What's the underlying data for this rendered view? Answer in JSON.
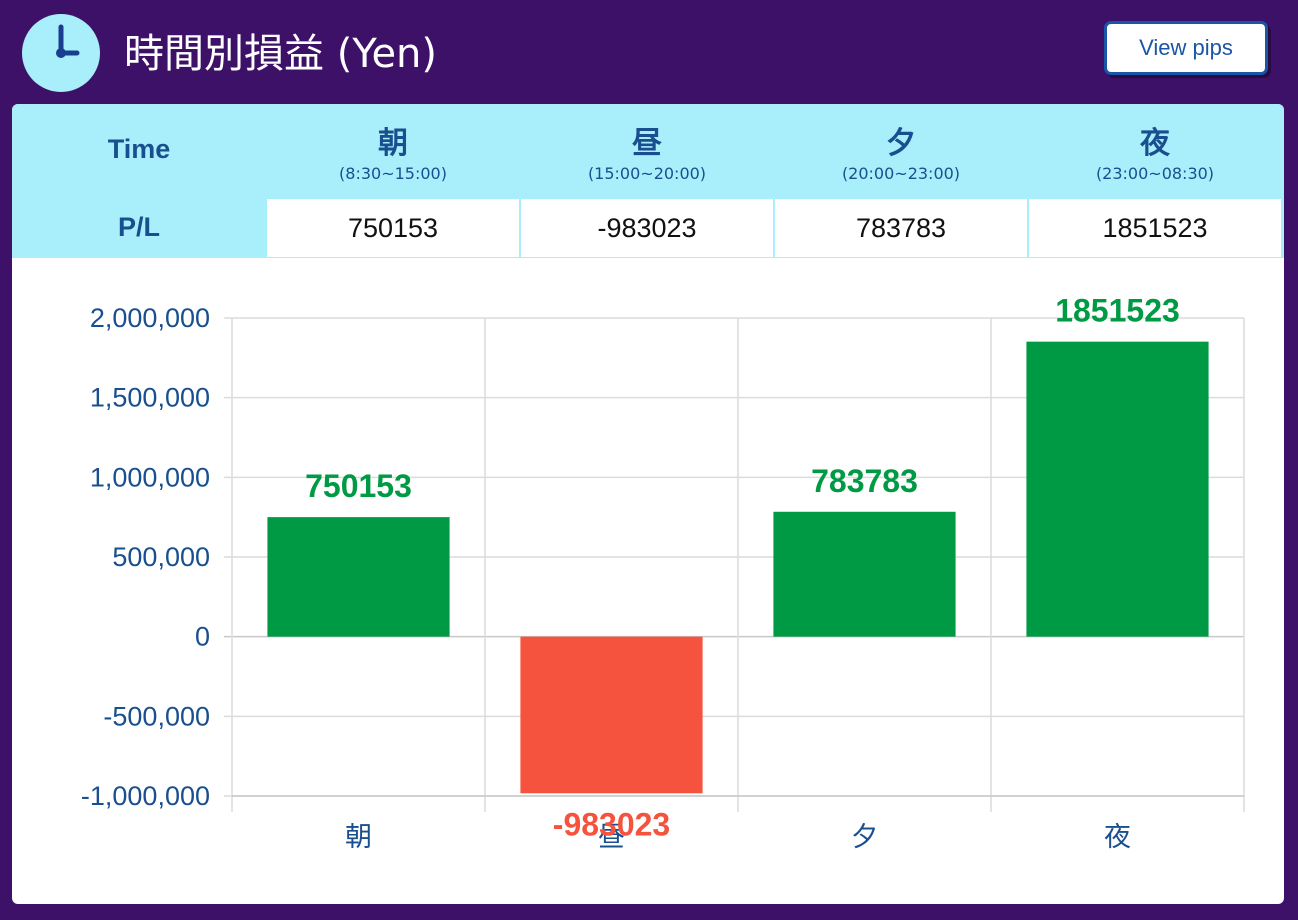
{
  "header": {
    "title": "時間別損益 (Yen)",
    "icon": "clock-icon",
    "view_button_label": "View pips"
  },
  "table": {
    "row_time_label": "Time",
    "row_pl_label": "P/L",
    "periods": [
      {
        "name": "朝",
        "range": "(8:30~15:00)",
        "pl": "750153"
      },
      {
        "name": "昼",
        "range": "(15:00~20:00)",
        "pl": "-983023"
      },
      {
        "name": "夕",
        "range": "(20:00~23:00)",
        "pl": "783783"
      },
      {
        "name": "夜",
        "range": "(23:00~08:30)",
        "pl": "1851523"
      }
    ]
  },
  "colors": {
    "background": "#3d1168",
    "header_row": "#a8eefb",
    "positive": "#009944",
    "negative": "#f5533d",
    "axis_text": "#1a4f8f"
  },
  "chart_data": {
    "type": "bar",
    "categories": [
      "朝",
      "昼",
      "夕",
      "夜"
    ],
    "values": [
      750153,
      -983023,
      783783,
      1851523
    ],
    "data_labels": [
      "750153",
      "-983023",
      "783783",
      "1851523"
    ],
    "ylim": [
      -1000000,
      2000000
    ],
    "yticks": [
      2000000,
      1500000,
      1000000,
      500000,
      0,
      -500000,
      -1000000
    ],
    "ytick_labels": [
      "2,000,000",
      "1,500,000",
      "1,000,000",
      "500,000",
      "0",
      "-500,000",
      "-1,000,000"
    ],
    "grid": true,
    "title": "",
    "xlabel": "",
    "ylabel": ""
  }
}
